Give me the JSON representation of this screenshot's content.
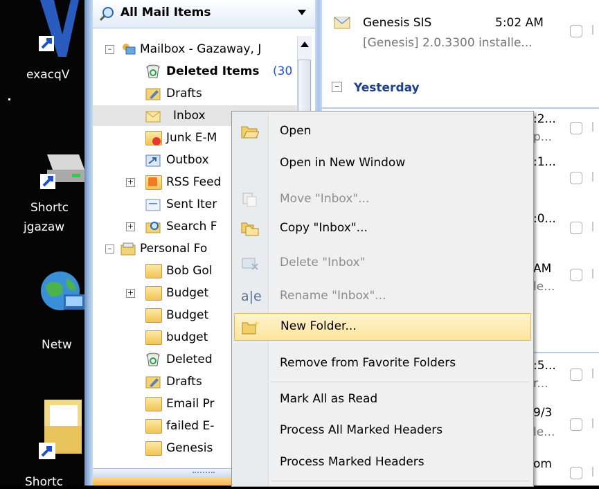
{
  "desktop": {
    "icons": [
      {
        "name": "exacq-icon",
        "label": "exacqV"
      },
      {
        "name": "drive-shortcut-icon",
        "label": "Shortc"
      },
      {
        "name": "drive-shortcut-icon-2",
        "label": "jgazaw"
      },
      {
        "name": "network-icon",
        "label": "Netw"
      },
      {
        "name": "folder-shortcut-icon",
        "label": "Shortc"
      }
    ]
  },
  "nav": {
    "header_title": "All Mail Items",
    "tree": [
      {
        "label": "Mailbox - Gazaway, J"
      },
      {
        "label": "Deleted Items",
        "count": "(30"
      },
      {
        "label": "Drafts"
      },
      {
        "label": "Inbox"
      },
      {
        "label": "Junk E-M"
      },
      {
        "label": "Outbox"
      },
      {
        "label": "RSS Feed"
      },
      {
        "label": "Sent Iter"
      },
      {
        "label": "Search F"
      },
      {
        "label": "Personal Fo"
      },
      {
        "label": "Bob Gol"
      },
      {
        "label": "Budget"
      },
      {
        "label": "Budget"
      },
      {
        "label": "budget"
      },
      {
        "label": "Deleted"
      },
      {
        "label": "Drafts"
      },
      {
        "label": "Email Pr"
      },
      {
        "label": "failed E-"
      },
      {
        "label": "Genesis"
      }
    ]
  },
  "list": {
    "item1": {
      "sender": "Genesis SIS",
      "time": "5:02 AM",
      "preview": "[Genesis] 2.0.3300 installe..."
    },
    "group_label": "Yesterday",
    "fragments": [
      {
        "a": ":2...",
        "b": "p..."
      },
      {
        "a": ":1..."
      },
      {
        "a": ":0..."
      },
      {
        "a": "AM",
        "b": "le..."
      },
      {
        "a": ":5...",
        "b": "r..."
      },
      {
        "a": "9/3",
        "b": "le..."
      },
      {
        "a": "om"
      }
    ]
  },
  "menu": {
    "items": [
      {
        "label": "Open",
        "enabled": true
      },
      {
        "label": "Open in New Window",
        "enabled": true
      },
      {
        "label": "Move \"Inbox\"...",
        "enabled": false
      },
      {
        "label": "Copy \"Inbox\"...",
        "enabled": true
      },
      {
        "label": "Delete \"Inbox\"",
        "enabled": false
      },
      {
        "label": "Rename \"Inbox\"...",
        "enabled": false
      },
      {
        "label": "New Folder...",
        "enabled": true,
        "highlighted": true
      },
      {
        "label": "Remove from Favorite Folders",
        "enabled": true
      },
      {
        "label": "Mark All as Read",
        "enabled": true
      },
      {
        "label": "Process All Marked Headers",
        "enabled": true
      },
      {
        "label": "Process Marked Headers",
        "enabled": true
      }
    ]
  },
  "colors": {
    "accent_blue": "#1f3f8f",
    "count_blue": "#1f4fe0",
    "highlight": "#fde59d"
  }
}
